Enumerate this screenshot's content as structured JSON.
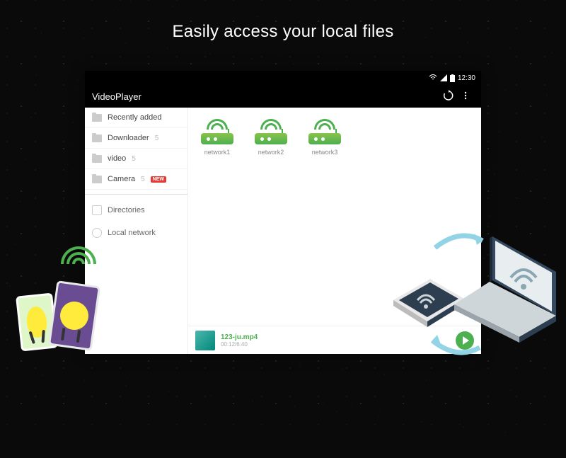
{
  "tagline": "Easily access your local files",
  "status": {
    "time": "12:30"
  },
  "app": {
    "title": "VideoPlayer",
    "refresh_icon": "refresh-icon",
    "menu_icon": "more-icon"
  },
  "sidebar": {
    "items": [
      {
        "label": "Recently added",
        "count": ""
      },
      {
        "label": "Downloader",
        "count": "5"
      },
      {
        "label": "video",
        "count": "5"
      },
      {
        "label": "Camera",
        "count": "5",
        "badge": "NEW"
      }
    ],
    "directories_label": "Directories",
    "local_network_label": "Local network"
  },
  "networks": [
    {
      "label": "network1"
    },
    {
      "label": "network2"
    },
    {
      "label": "network3"
    }
  ],
  "nowplaying": {
    "filename": "123-ju.mp4",
    "time": "00:12/6:40"
  }
}
